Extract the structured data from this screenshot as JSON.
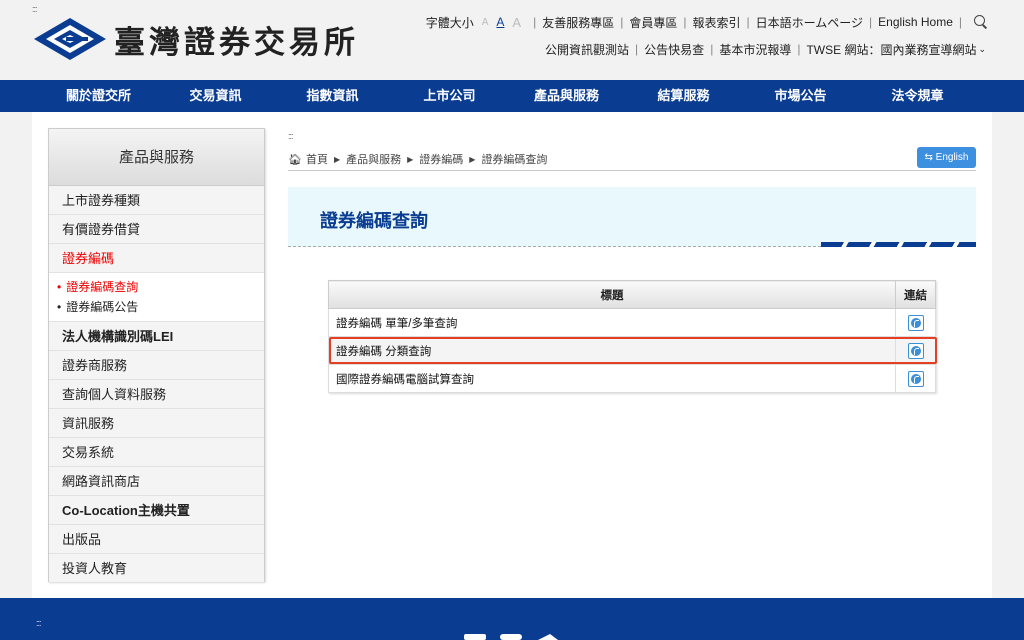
{
  "header": {
    "skip_dots": ":::",
    "logo_text": "臺灣證券交易所",
    "font_size_label": "字體大小",
    "font_sizes": [
      "A",
      "A",
      "A"
    ],
    "util_links_1": [
      "友善服務專區",
      "會員專區",
      "報表索引",
      "日本語ホームページ",
      "English Home"
    ],
    "util_links_2": [
      "公開資訊觀測站",
      "公告快易查",
      "基本市況報導",
      "TWSE 網站：國內業務宣導網站"
    ]
  },
  "nav": [
    "關於證交所",
    "交易資訊",
    "指數資訊",
    "上市公司",
    "產品與服務",
    "結算服務",
    "市場公告",
    "法令規章"
  ],
  "sidebar": {
    "title": "產品與服務",
    "items_top": [
      "上市證券種類",
      "有價證券借貸"
    ],
    "active_item": "證券編碼",
    "sub_items": [
      "證券編碼查詢",
      "證券編碼公告"
    ],
    "items_bottom": [
      "法人機構識別碼LEI",
      "證券商服務",
      "查詢個人資料服務",
      "資訊服務",
      "交易系統",
      "網路資訊商店",
      "Co-Location主機共置",
      "出版品",
      "投資人教育"
    ]
  },
  "content": {
    "skip_dots": ":::",
    "breadcrumb": [
      "首頁",
      "產品與服務",
      "證券編碼",
      "證券編碼查詢"
    ],
    "english_button": "English",
    "page_title": "證券編碼查詢",
    "table": {
      "headers": [
        "標題",
        "連結"
      ],
      "rows": [
        "證券編碼 單筆/多筆查詢",
        "證券編碼 分類查詢",
        "國際證券編碼電腦試算查詢"
      ]
    }
  },
  "footer": {
    "skip_dots": ":::"
  },
  "colors": {
    "brand_blue": "#0a3d91",
    "active_red": "#e00000",
    "highlight": "#e53e22",
    "english_btn": "#3d8fe0"
  }
}
